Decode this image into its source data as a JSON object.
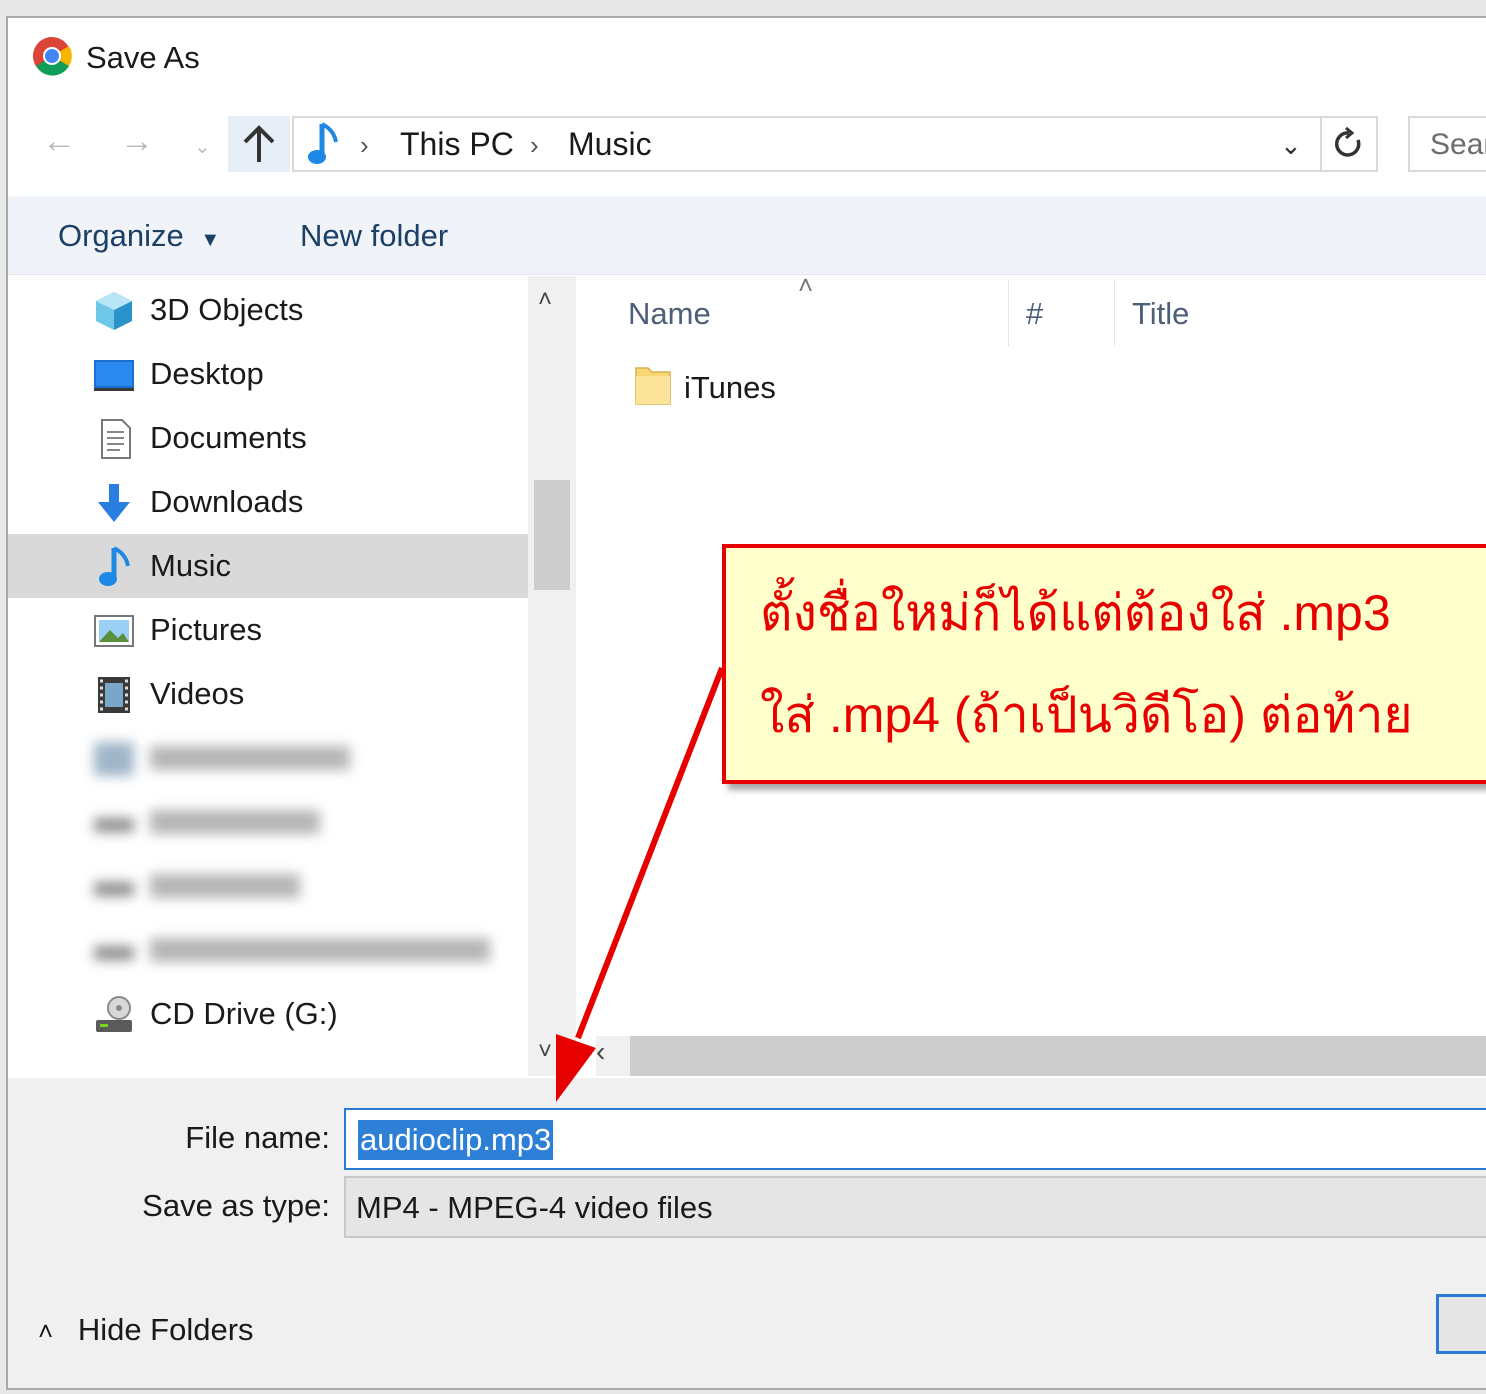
{
  "window": {
    "title": "Save As"
  },
  "address": {
    "crumbs": [
      "This PC",
      "Music"
    ],
    "search_placeholder": "Sear"
  },
  "toolbar": {
    "organize_label": "Organize",
    "new_folder_label": "New folder"
  },
  "nav": {
    "items": [
      {
        "label": "3D Objects",
        "icon": "3d-objects-icon"
      },
      {
        "label": "Desktop",
        "icon": "desktop-icon"
      },
      {
        "label": "Documents",
        "icon": "documents-icon"
      },
      {
        "label": "Downloads",
        "icon": "downloads-icon"
      },
      {
        "label": "Music",
        "icon": "music-icon",
        "selected": true
      },
      {
        "label": "Pictures",
        "icon": "pictures-icon"
      },
      {
        "label": "Videos",
        "icon": "videos-icon"
      },
      {
        "label": "CD Drive (G:)",
        "icon": "cd-drive-icon"
      }
    ]
  },
  "list": {
    "columns": [
      "Name",
      "#",
      "Title"
    ],
    "rows": [
      {
        "name": "iTunes",
        "icon": "folder-icon"
      }
    ]
  },
  "callout": {
    "line1": "ตั้งชื่อใหม่ก็ได้แต่ต้องใส่ .mp3",
    "line2": "ใส่ .mp4 (ถ้าเป็นวิดีโอ) ต่อท้าย"
  },
  "form": {
    "file_name_label": "File name:",
    "file_name_value": "audioclip.mp3",
    "save_type_label": "Save as type:",
    "save_type_value": "MP4 - MPEG-4 video files"
  },
  "footer": {
    "hide_folders_label": "Hide Folders"
  },
  "colors": {
    "accent": "#2b7bd6",
    "callout_border": "#e60000",
    "callout_bg": "#ffffcc",
    "selection": "#d9d9d9"
  }
}
